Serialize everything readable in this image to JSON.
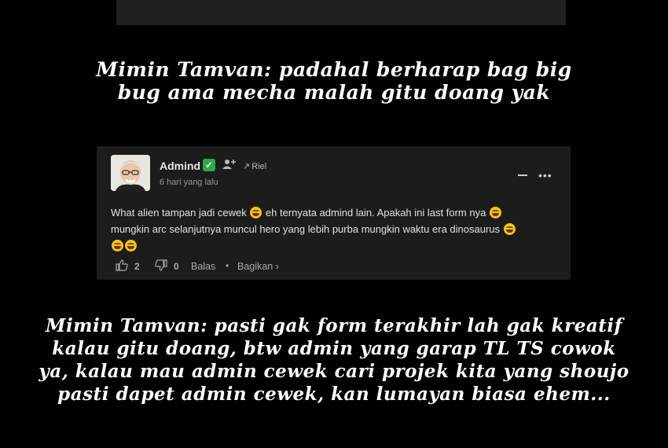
{
  "captions": {
    "first": [
      "Mimin Tamvan: padahal berharap bag big",
      "bug ama mecha malah gitu doang yak"
    ],
    "second": [
      "Mimin Tamvan: pasti gak form terakhir lah gak kreatif",
      "kalau gitu doang, btw admin yang garap TL TS cowok",
      "ya, kalau mau admin cewek cari projek kita yang shoujo",
      "pasti dapet admin cewek, kan lumayan biasa ehem..."
    ]
  },
  "comment": {
    "author": "Admind",
    "verified_icon": "✓",
    "reply_to": "Riel",
    "timestamp": "6 hari yang lalu",
    "body_parts": [
      "What alien tampan jadi cewek ",
      " eh ternyata admind lain. Apakah ini last form nya ",
      "mungkin arc selanjutnya muncul hero yang lebih purba mungkin waktu era dinosaurus "
    ],
    "likes": "2",
    "dislikes": "0",
    "reply_label": "Balas",
    "share_label": "Bagikan ›",
    "separator": "•"
  },
  "colors": {
    "background": "#000000",
    "card": "#1c1c1c",
    "verified": "#2aa84a"
  }
}
